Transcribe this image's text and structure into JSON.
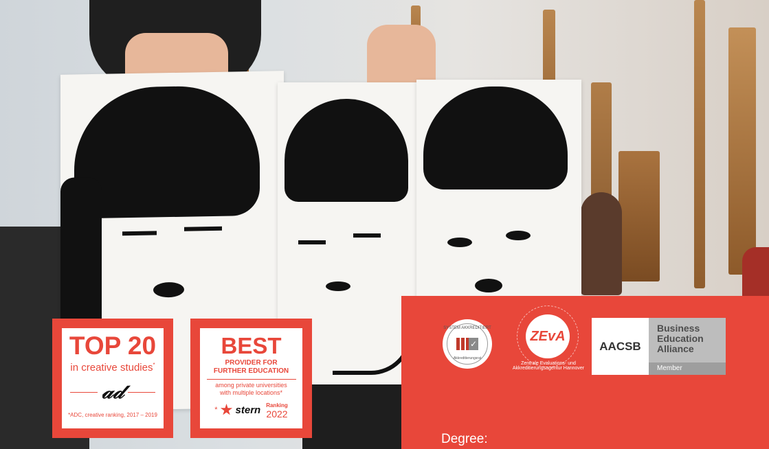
{
  "badge_top20": {
    "title": "TOP 20",
    "subtitle": "in creative studies",
    "asterisk": "*",
    "logo": "ADC",
    "footnote": "*ADC, creative ranking, 2017 – 2019"
  },
  "badge_best": {
    "title": "BEST",
    "subtitle_line1": "PROVIDER FOR",
    "subtitle_line2": "FURTHER EDUCATION",
    "note_line1": "among private universities",
    "note_line2": "with multiple locations*",
    "asterisk": "*",
    "brand": "stern",
    "ranking_label": "Ranking",
    "ranking_year": "2022"
  },
  "accreditations": {
    "seal1_top": "SYSTEM AKKREDITIERT",
    "seal1_bottom": "Akkreditierungsrat",
    "zeva_word": "ZEvA",
    "zeva_caption": "Zentrale Evaluations- und Akkreditierungsagentur Hannover",
    "aacsb_left": "AACSB",
    "aacsb_line1": "Business",
    "aacsb_line2": "Education",
    "aacsb_line3": "Alliance",
    "aacsb_member": "Member"
  },
  "panel": {
    "degree_label": "Degree:"
  },
  "colors": {
    "accent": "#e8473a",
    "white": "#ffffff"
  }
}
